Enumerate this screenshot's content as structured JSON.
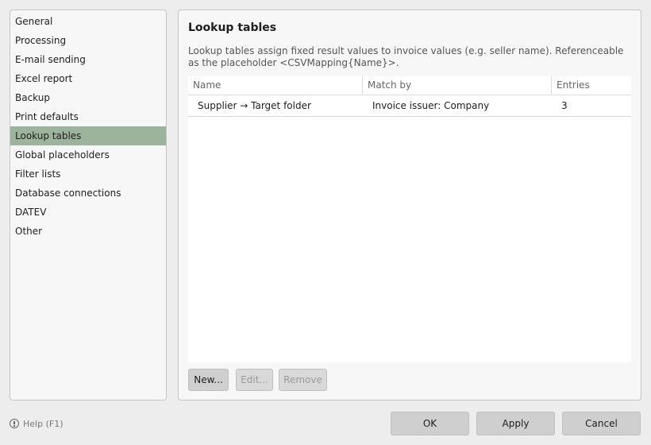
{
  "sidebar": {
    "items": [
      {
        "label": "General"
      },
      {
        "label": "Processing"
      },
      {
        "label": "E-mail sending"
      },
      {
        "label": "Excel report"
      },
      {
        "label": "Backup"
      },
      {
        "label": "Print defaults"
      },
      {
        "label": "Lookup tables",
        "selected": true
      },
      {
        "label": "Global placeholders"
      },
      {
        "label": "Filter lists"
      },
      {
        "label": "Database connections"
      },
      {
        "label": "DATEV"
      },
      {
        "label": "Other"
      }
    ],
    "selected_color": "#9db49c"
  },
  "panel": {
    "title": "Lookup tables",
    "description": "Lookup tables assign fixed result values to invoice values (e.g. seller name). Referenceable as the placeholder <CSVMapping{Name}>.",
    "table": {
      "columns": [
        "Name",
        "Match by",
        "Entries"
      ],
      "rows": [
        {
          "name": "Supplier → Target folder",
          "match_by": "Invoice issuer: Company",
          "entries": "3"
        }
      ]
    },
    "buttons": {
      "new": "New...",
      "edit": "Edit...",
      "remove": "Remove"
    }
  },
  "footer": {
    "help_label": "Help (F1)",
    "ok": "OK",
    "apply": "Apply",
    "cancel": "Cancel"
  }
}
